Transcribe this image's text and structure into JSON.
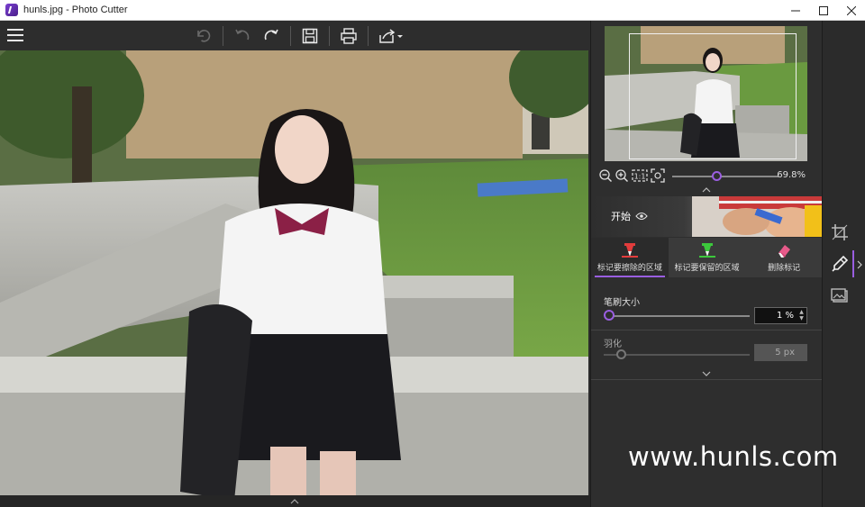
{
  "window": {
    "title": "hunls.jpg - Photo Cutter"
  },
  "toolbar": {
    "buttons": [
      "menu",
      "undo-all",
      "undo",
      "redo",
      "save",
      "print",
      "share"
    ]
  },
  "navigator": {
    "zoom": "69.8%"
  },
  "start": {
    "label": "开始"
  },
  "tabs": [
    {
      "label": "标记要擦除的区域",
      "color": "#e23c3c"
    },
    {
      "label": "标记要保留的区域",
      "color": "#3cc83c"
    },
    {
      "label": "删除标记",
      "color": "#e85a8a"
    }
  ],
  "brush": {
    "label": "笔刷大小",
    "value": "1 %"
  },
  "feather": {
    "label": "羽化",
    "value": "5 px"
  },
  "watermark": "www.hunls.com",
  "colors": {
    "accent": "#9a5ee0",
    "panel": "#2e2e2e",
    "toolbar": "#2d2d2d"
  }
}
